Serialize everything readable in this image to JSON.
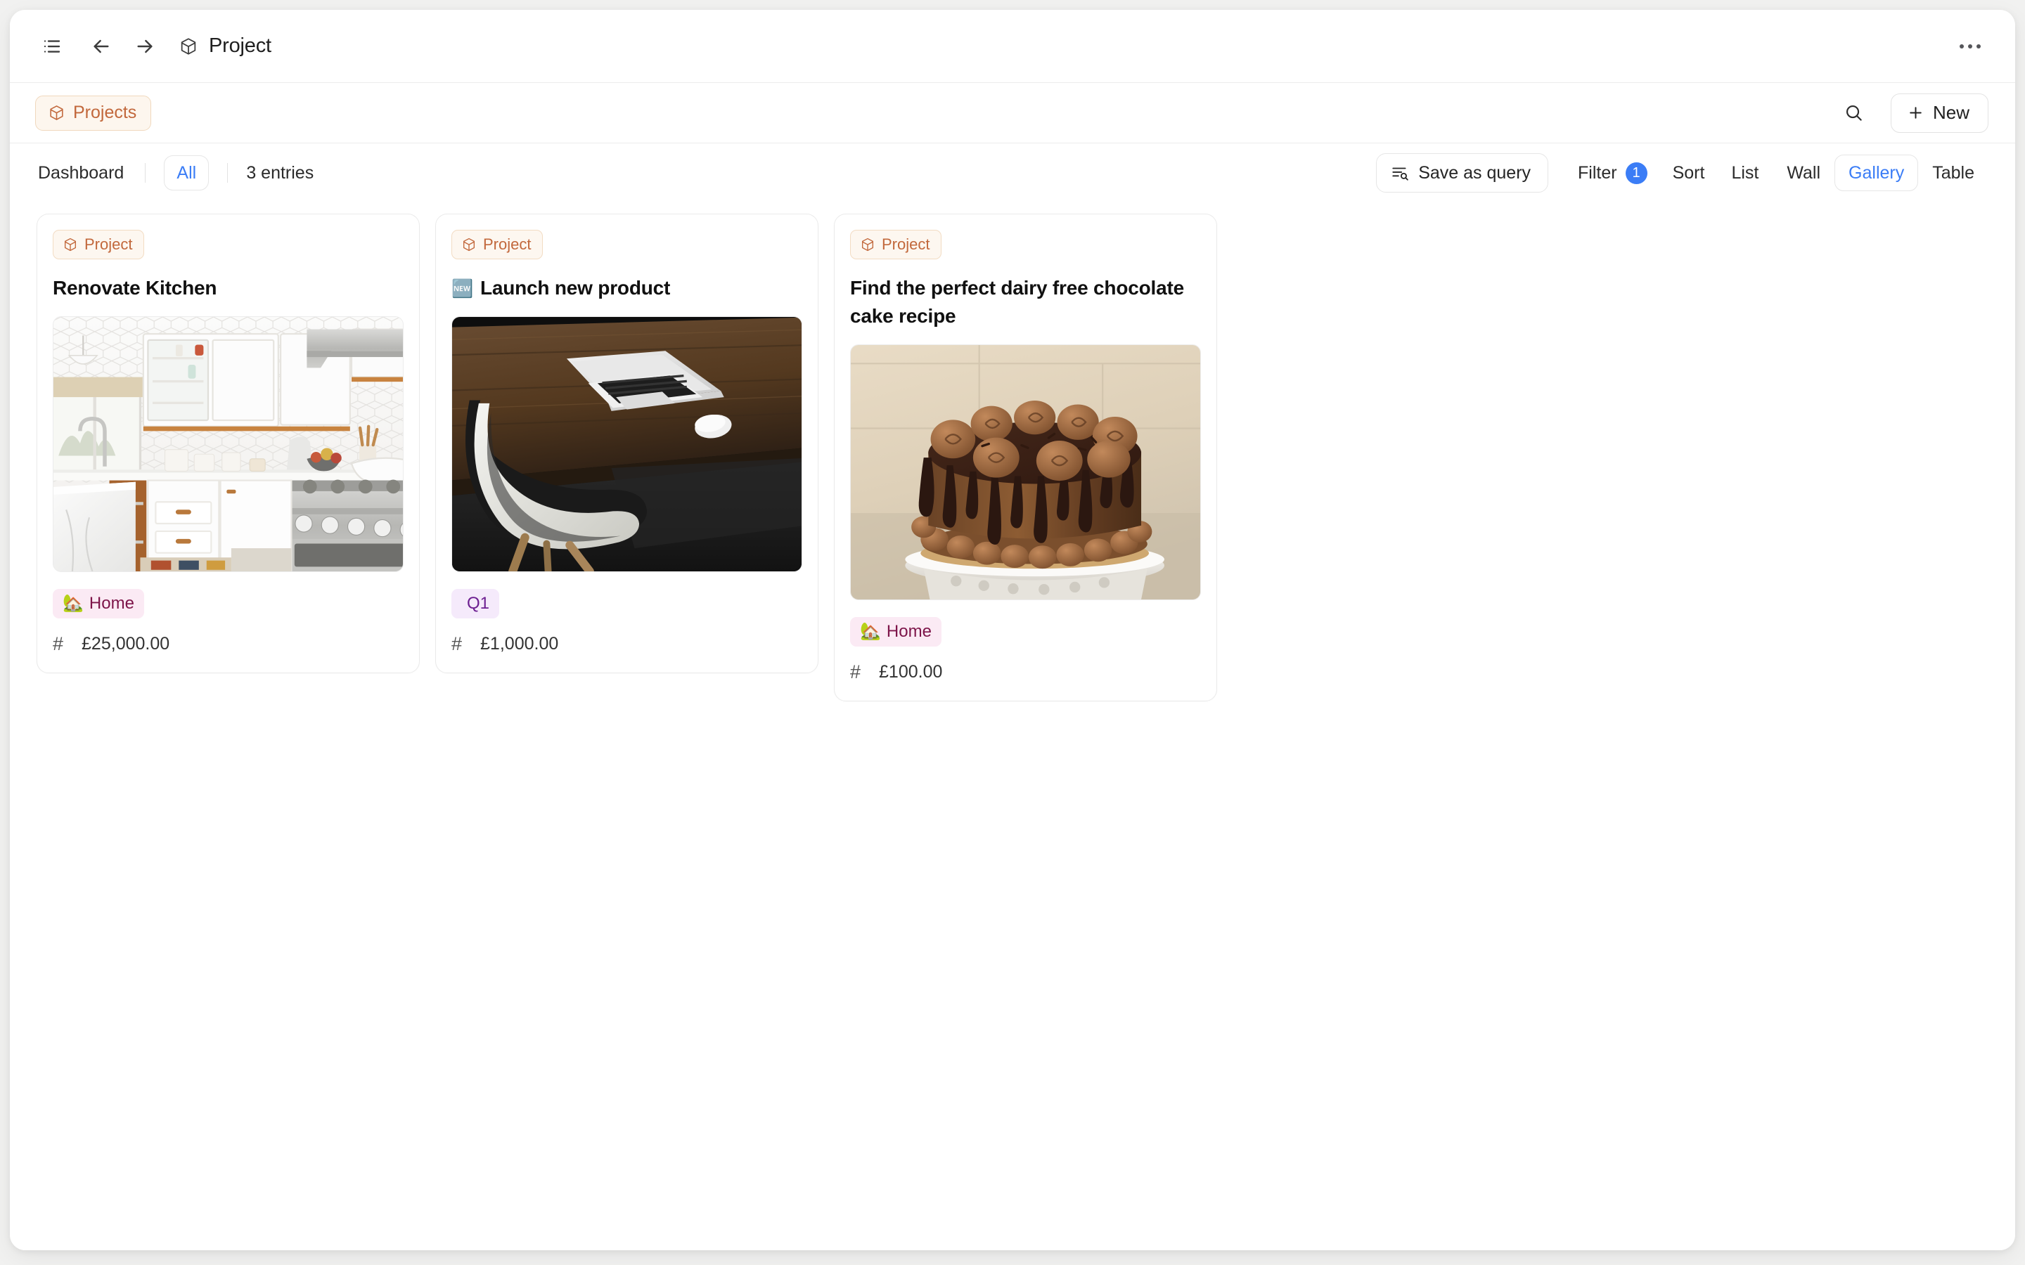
{
  "window": {
    "titlebar": {
      "sidebar_toggle_icon": "list-sidebar-icon",
      "back_icon": "arrow-left-icon",
      "forward_icon": "arrow-right-icon",
      "page_icon": "box-icon",
      "title": "Project",
      "more_icon": "more-horizontal-icon"
    },
    "crumbbar": {
      "breadcrumb_icon": "box-icon",
      "breadcrumb_label": "Projects",
      "search_icon": "search-icon",
      "new_icon": "plus-icon",
      "new_label": "New"
    },
    "viewbar": {
      "dashboard_label": "Dashboard",
      "all_label": "All",
      "entries_label": "3 entries",
      "save_as_query_icon": "list-search-icon",
      "save_as_query_label": "Save as query",
      "filter_label": "Filter",
      "filter_count": "1",
      "sort_label": "Sort",
      "views": [
        {
          "label": "List",
          "active": false
        },
        {
          "label": "Wall",
          "active": false
        },
        {
          "label": "Gallery",
          "active": true
        },
        {
          "label": "Table",
          "active": false
        }
      ]
    }
  },
  "colors": {
    "accent_blue": "#3b7df6",
    "project_orange": "#c2683c",
    "project_orange_bg": "#fdf7f0",
    "tag_pink_bg": "#fbeaf4",
    "tag_pink_text": "#7d1449",
    "tag_purple_bg": "#f5eafb",
    "tag_purple_text": "#6d1f91"
  },
  "gallery": {
    "cards": [
      {
        "badge": "Project",
        "badge_icon": "box-icon",
        "title_emoji": "",
        "title": "Renovate Kitchen",
        "image_alt": "white-kitchen-photo",
        "tag": "Home",
        "tag_emoji": "🏡",
        "tag_style": "pink",
        "number_icon": "hash-icon",
        "number": "£25,000.00"
      },
      {
        "badge": "Project",
        "badge_icon": "box-icon",
        "title_emoji": "🆕",
        "title": "Launch new product",
        "image_alt": "laptop-on-dark-desk-photo",
        "tag": "Q1",
        "tag_emoji": "",
        "tag_style": "purple",
        "number_icon": "hash-icon",
        "number": "£1,000.00"
      },
      {
        "badge": "Project",
        "badge_icon": "box-icon",
        "title_emoji": "",
        "title": "Find the perfect dairy free chocolate cake recipe",
        "image_alt": "chocolate-drip-cake-photo",
        "tag": "Home",
        "tag_emoji": "🏡",
        "tag_style": "pink",
        "number_icon": "hash-icon",
        "number": "£100.00"
      }
    ]
  }
}
